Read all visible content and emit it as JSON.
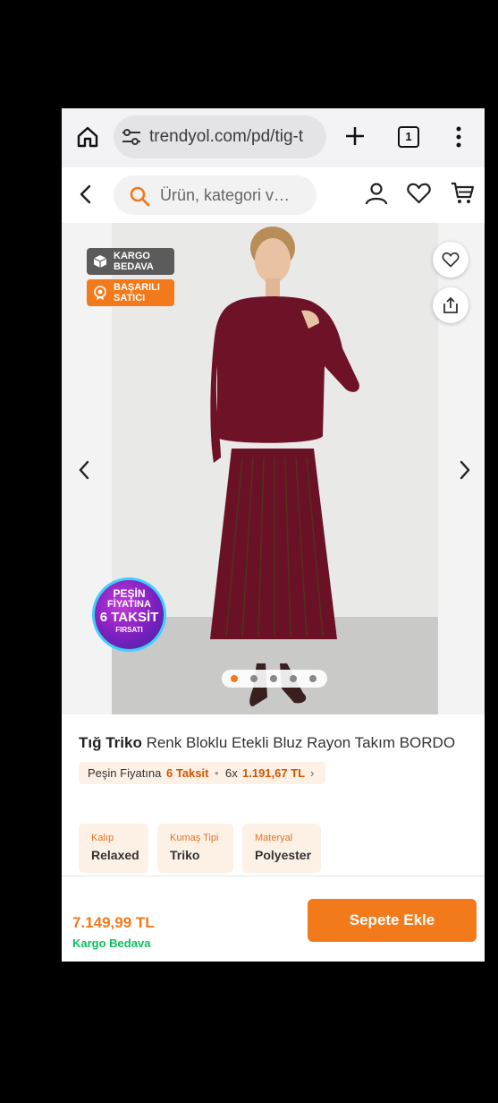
{
  "browser": {
    "url": "trendyol.com/pd/tig-t",
    "tab_count": "1",
    "icons": [
      "home-icon",
      "tune-icon",
      "plus-icon",
      "tabs-icon",
      "more-vert-icon"
    ]
  },
  "header": {
    "search_placeholder": "Ürün, kategori v…",
    "icons": [
      "back-icon",
      "search-icon",
      "user-icon",
      "heart-icon",
      "cart-icon"
    ]
  },
  "gallery": {
    "badge_cargo": [
      "KARGO",
      "BEDAVA"
    ],
    "badge_seller": [
      "BAŞARILI",
      "SATICI"
    ],
    "promo": [
      "PEŞİN",
      "FİYATINA",
      "6 TAKSİT",
      "FIRSATI"
    ],
    "dots_total": 5,
    "active_dot": 1
  },
  "product": {
    "brand": "Tığ Triko",
    "name": "Renk Bloklu Etekli Bluz Rayon Takım BORDO",
    "installment": {
      "prefix": "Peşin Fiyatına",
      "highlight": "6 Taksit",
      "separator": "•",
      "count": "6x",
      "amount": "1.191,67 TL",
      "chevron": "›"
    },
    "attributes": [
      {
        "key": "Kalıp",
        "value": "Relaxed"
      },
      {
        "key": "Kumaş Tipi",
        "value": "Triko"
      },
      {
        "key": "Materyal",
        "value": "Polyester"
      }
    ]
  },
  "bottom": {
    "price": "7.149,99 TL",
    "shipping": "Kargo Bedava",
    "add_to_cart": "Sepete Ekle"
  },
  "colors": {
    "brand_orange": "#f27a1a",
    "free_shipping_green": "#0bc15c",
    "attribute_bg": "#fdf1e6",
    "garment": "#6e1228"
  }
}
